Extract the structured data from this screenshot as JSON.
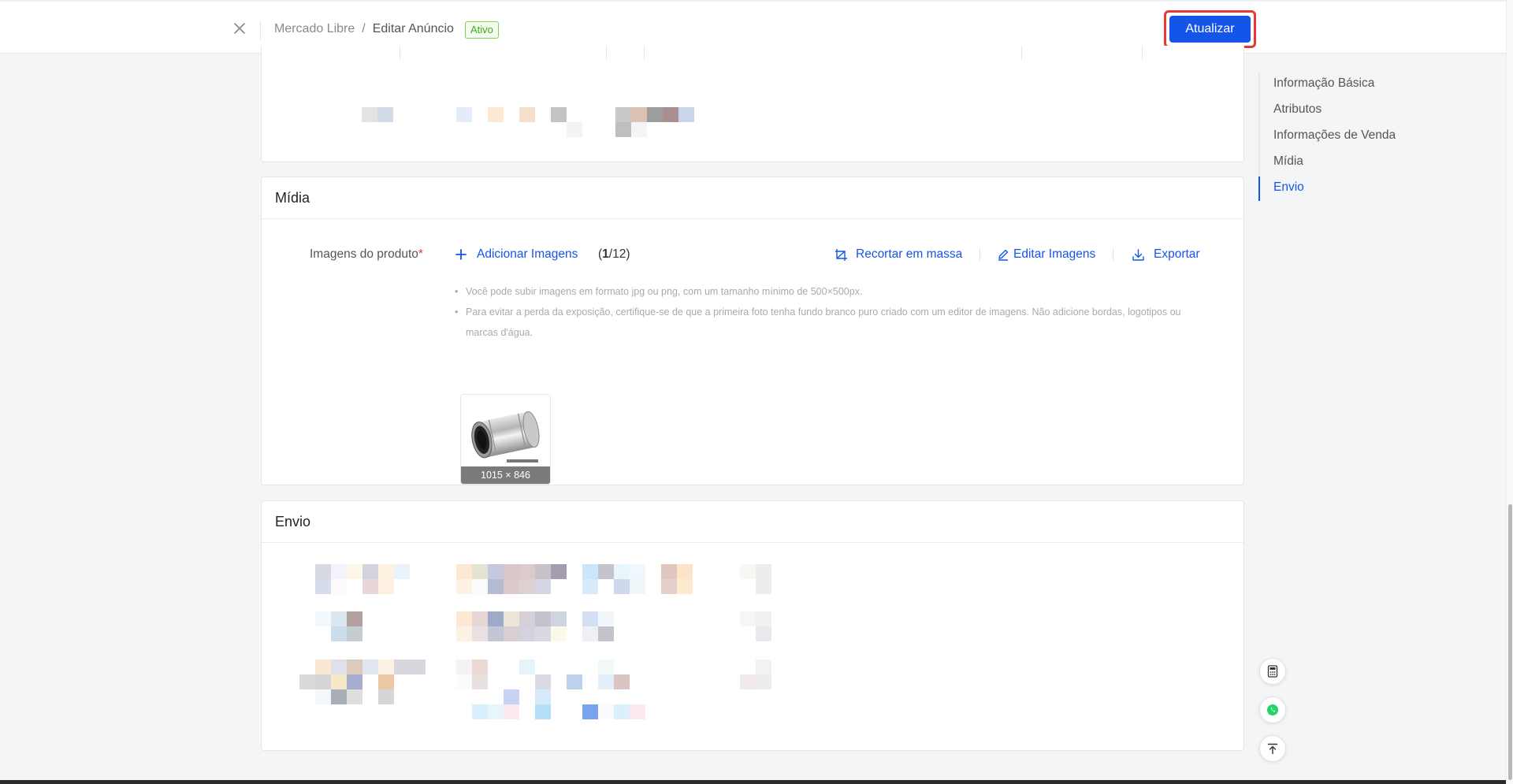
{
  "header": {
    "breadcrumb_root": "Mercado Libre",
    "breadcrumb_separator": "/",
    "breadcrumb_current": "Editar Anúncio",
    "status_badge": "Ativo",
    "update_button": "Atualizar"
  },
  "anchor_nav": {
    "items": [
      {
        "label": "Informação Básica"
      },
      {
        "label": "Atributos"
      },
      {
        "label": "Informações de Venda"
      },
      {
        "label": "Mídia"
      },
      {
        "label": "Envio"
      }
    ],
    "active": "Envio"
  },
  "media": {
    "title": "Mídia",
    "field_label": "Imagens do produto",
    "required_mark": "*",
    "add_images": "Adicionar Imagens",
    "count_current": "1",
    "count_rest": "/12)",
    "count_open": "(",
    "bulk_crop": "Recortar em massa",
    "edit_images": "Editar Imagens",
    "export": "Exportar",
    "tips": [
      "Você pode subir imagens em formato jpg ou png, com um tamanho mínimo de 500×500px.",
      "Para evitar a perda da exposição, certifique-se de que a primeira foto tenha fundo branco puro criado com um editor de imagens. Não adicione bordas, logotipos ou marcas d'água."
    ],
    "image_dimensions": "1015 × 846"
  },
  "shipping": {
    "title": "Envio"
  },
  "colors": {
    "primary": "#1554e8",
    "active_green": "#3fae18",
    "highlight_red": "#e53935",
    "whatsapp": "#25d366"
  },
  "icons": {
    "close": "close-icon",
    "add": "plus-icon",
    "crop": "crop-icon",
    "edit": "pencil-icon",
    "export": "download-icon",
    "calculator": "calculator-icon",
    "whatsapp": "whatsapp-icon",
    "back_to_top": "back-to-top-icon"
  }
}
